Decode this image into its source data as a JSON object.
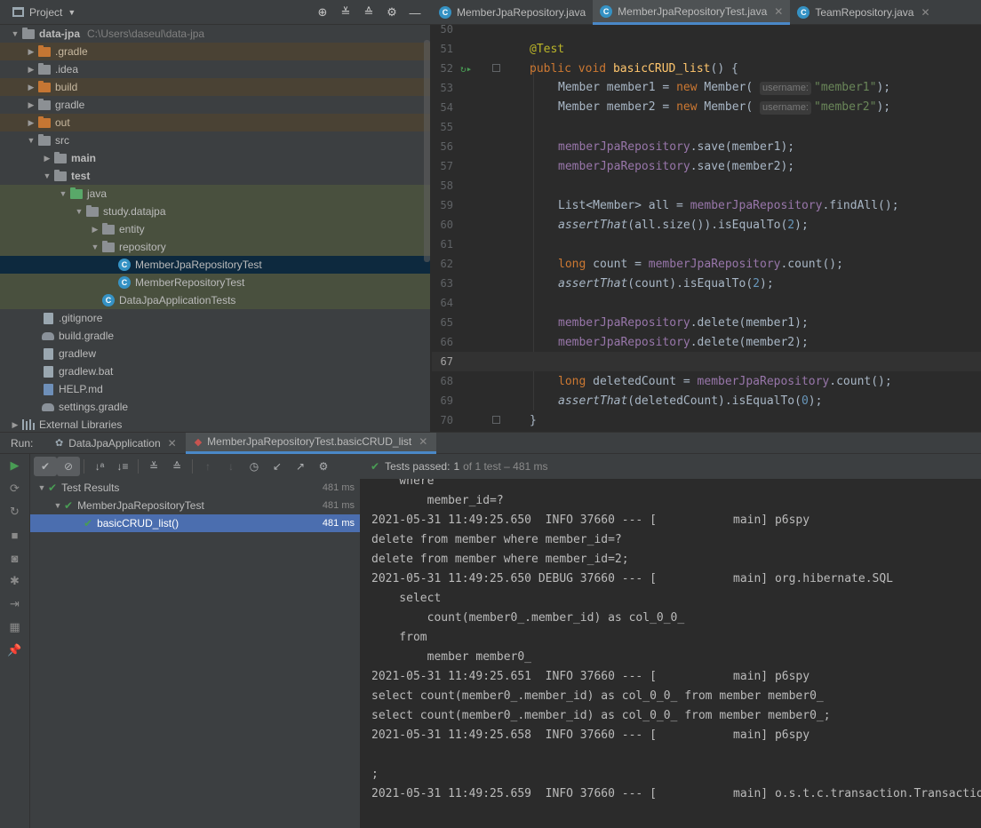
{
  "project": {
    "title": "Project",
    "tree": [
      {
        "label": "data-jpa",
        "path": "C:\\Users\\daseul\\data-jpa",
        "bold": true
      },
      {
        "label": ".gradle"
      },
      {
        "label": ".idea"
      },
      {
        "label": "build"
      },
      {
        "label": "gradle"
      },
      {
        "label": "out"
      },
      {
        "label": "src"
      },
      {
        "label": "main"
      },
      {
        "label": "test"
      },
      {
        "label": "java"
      },
      {
        "label": "study.datajpa"
      },
      {
        "label": "entity"
      },
      {
        "label": "repository"
      },
      {
        "label": "MemberJpaRepositoryTest"
      },
      {
        "label": "MemberRepositoryTest"
      },
      {
        "label": "DataJpaApplicationTests"
      },
      {
        "label": ".gitignore"
      },
      {
        "label": "build.gradle"
      },
      {
        "label": "gradlew"
      },
      {
        "label": "gradlew.bat"
      },
      {
        "label": "HELP.md"
      },
      {
        "label": "settings.gradle"
      },
      {
        "label": "External Libraries"
      }
    ]
  },
  "editor": {
    "tabs": [
      {
        "label": "MemberJpaRepository.java"
      },
      {
        "label": "MemberJpaRepositoryTest.java"
      },
      {
        "label": "TeamRepository.java"
      }
    ],
    "line_numbers": [
      "50",
      "51",
      "52",
      "53",
      "54",
      "55",
      "56",
      "57",
      "58",
      "59",
      "60",
      "61",
      "62",
      "63",
      "64",
      "65",
      "66",
      "67",
      "68",
      "69",
      "70"
    ],
    "hints": {
      "username": "username:"
    },
    "tokens": {
      "test_ann": "@Test",
      "public": "public",
      "void": "void",
      "method": "basicCRUD_list",
      "new": "new",
      "long": "long",
      "member_type": "Member",
      "member1": "member1",
      "member2": "member2",
      "str1": "\"member1\"",
      "str2": "\"member2\"",
      "repo": "memberJpaRepository",
      "list_decl": "List<Member> all = ",
      "find_all": ".findAll();",
      "assert_that": "assertThat",
      "size_check": "(all.size()).isEqualTo(",
      "count_decl": " count = ",
      "count_call": ".count();",
      "count_check": "(count).isEqualTo(",
      "deleted_decl": " deletedCount = ",
      "deleted_check": "(deletedCount).isEqualTo(",
      "save1": ".save(member1);",
      "save2": ".save(member2);",
      "delete1": ".delete(member1);",
      "delete2": ".delete(member2);",
      "two": "2",
      "zero": "0",
      "close_paren": ");",
      "open_brace": "() {",
      "close_brace": "}"
    }
  },
  "run": {
    "label": "Run:",
    "tabs": [
      {
        "label": "DataJpaApplication"
      },
      {
        "label": "MemberJpaRepositoryTest.basicCRUD_list"
      }
    ],
    "status": {
      "passed": "Tests passed:",
      "count": "1",
      "rest": "of 1 test – 481 ms"
    },
    "tests": [
      {
        "label": "Test Results",
        "time": "481 ms"
      },
      {
        "label": "MemberJpaRepositoryTest",
        "time": "481 ms"
      },
      {
        "label": "basicCRUD_list()",
        "time": "481 ms"
      }
    ],
    "console": [
      "    where",
      "        member_id=?",
      "2021-05-31 11:49:25.650  INFO 37660 --- [           main] p6spy",
      "delete from member where member_id=?",
      "delete from member where member_id=2;",
      "2021-05-31 11:49:25.650 DEBUG 37660 --- [           main] org.hibernate.SQL",
      "    select",
      "        count(member0_.member_id) as col_0_0_",
      "    from",
      "        member member0_",
      "2021-05-31 11:49:25.651  INFO 37660 --- [           main] p6spy",
      "select count(member0_.member_id) as col_0_0_ from member member0_",
      "select count(member0_.member_id) as col_0_0_ from member member0_;",
      "2021-05-31 11:49:25.658  INFO 37660 --- [           main] p6spy",
      "",
      ";",
      "2021-05-31 11:49:25.659  INFO 37660 --- [           main] o.s.t.c.transaction.TransactionContext"
    ]
  }
}
